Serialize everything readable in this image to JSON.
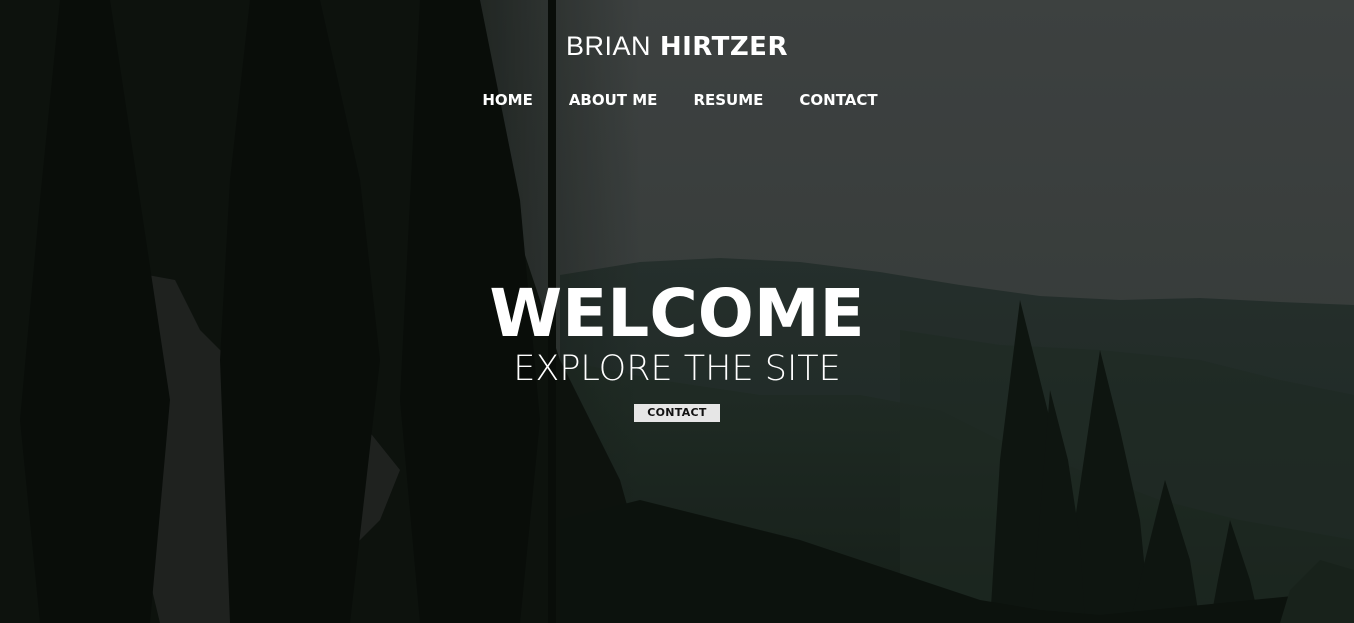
{
  "brand": {
    "first": "BRIAN",
    "last": "HIRTZER"
  },
  "nav": {
    "items": [
      {
        "label": "HOME"
      },
      {
        "label": "ABOUT ME"
      },
      {
        "label": "RESUME"
      },
      {
        "label": "CONTACT"
      }
    ]
  },
  "hero": {
    "title": "WELCOME",
    "subtitle": "EXPLORE THE SITE",
    "cta_label": "CONTACT"
  },
  "colors": {
    "text": "#ffffff",
    "button_bg": "#e6e6e6",
    "button_text": "#111111",
    "sky": "#4a4f4e",
    "forest_dark": "#0f1410"
  }
}
